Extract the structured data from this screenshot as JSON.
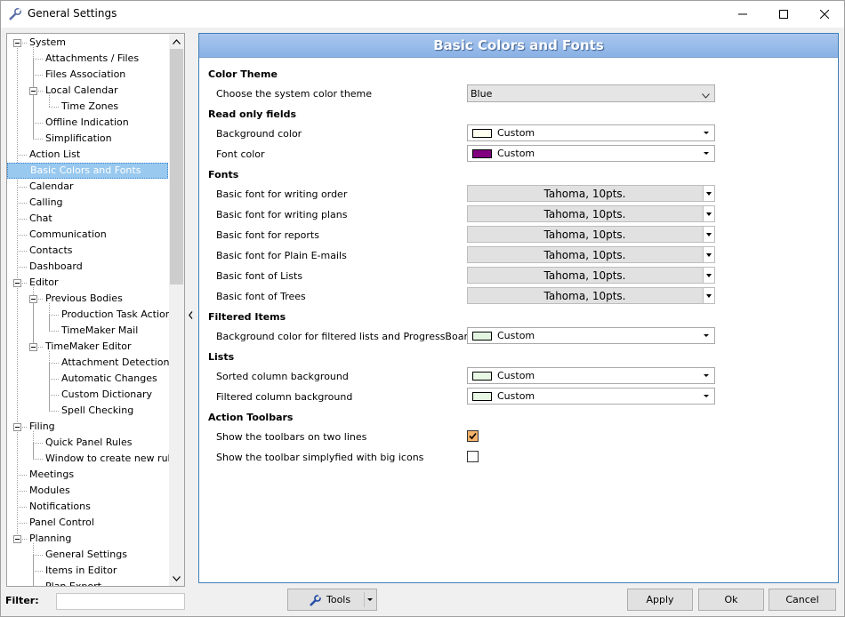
{
  "window": {
    "title": "General Settings"
  },
  "tree": {
    "items": [
      {
        "label": "System",
        "level": 0,
        "expander": true
      },
      {
        "label": "Attachments / Files",
        "level": 1
      },
      {
        "label": "Files Association",
        "level": 1
      },
      {
        "label": "Local Calendar",
        "level": 1,
        "expander": true
      },
      {
        "label": "Time Zones",
        "level": 2
      },
      {
        "label": "Offline Indication",
        "level": 1
      },
      {
        "label": "Simplification",
        "level": 1
      },
      {
        "label": "Action List",
        "level": 0
      },
      {
        "label": "Basic Colors and Fonts",
        "level": 0,
        "selected": true
      },
      {
        "label": "Calendar",
        "level": 0
      },
      {
        "label": "Calling",
        "level": 0
      },
      {
        "label": "Chat",
        "level": 0
      },
      {
        "label": "Communication",
        "level": 0
      },
      {
        "label": "Contacts",
        "level": 0
      },
      {
        "label": "Dashboard",
        "level": 0
      },
      {
        "label": "Editor",
        "level": 0,
        "expander": true
      },
      {
        "label": "Previous Bodies",
        "level": 1,
        "expander": true
      },
      {
        "label": "Production Task Action",
        "level": 2
      },
      {
        "label": "TimeMaker Mail",
        "level": 2
      },
      {
        "label": "TimeMaker Editor",
        "level": 1,
        "expander": true
      },
      {
        "label": "Attachment Detection",
        "level": 2
      },
      {
        "label": "Automatic Changes",
        "level": 2
      },
      {
        "label": "Custom Dictionary",
        "level": 2
      },
      {
        "label": "Spell Checking",
        "level": 2
      },
      {
        "label": "Filing",
        "level": 0,
        "expander": true
      },
      {
        "label": "Quick Panel Rules",
        "level": 1
      },
      {
        "label": "Window to create new rule",
        "level": 1
      },
      {
        "label": "Meetings",
        "level": 0
      },
      {
        "label": "Modules",
        "level": 0
      },
      {
        "label": "Notifications",
        "level": 0
      },
      {
        "label": "Panel Control",
        "level": 0
      },
      {
        "label": "Planning",
        "level": 0,
        "expander": true
      },
      {
        "label": "General Settings",
        "level": 1
      },
      {
        "label": "Items in Editor",
        "level": 1
      },
      {
        "label": "Plan Export",
        "level": 1
      }
    ]
  },
  "panel": {
    "title": "Basic Colors and Fonts",
    "color_theme": {
      "heading": "Color Theme",
      "label": "Choose the system color theme",
      "value": "Blue"
    },
    "read_only": {
      "heading": "Read only fields",
      "background_label": "Background color",
      "background_value": "Custom",
      "background_color": "#fffff0",
      "font_label": "Font color",
      "font_value": "Custom",
      "font_color": "#800080"
    },
    "fonts": {
      "heading": "Fonts",
      "rows": [
        {
          "label": "Basic font for writing order",
          "value": "Tahoma, 10pts."
        },
        {
          "label": "Basic font for writing plans",
          "value": "Tahoma, 10pts."
        },
        {
          "label": "Basic font for reports",
          "value": "Tahoma, 10pts."
        },
        {
          "label": "Basic font for Plain E-mails",
          "value": "Tahoma, 10pts."
        },
        {
          "label": "Basic font of Lists",
          "value": "Tahoma, 10pts."
        },
        {
          "label": "Basic font of Trees",
          "value": "Tahoma, 10pts."
        }
      ]
    },
    "filtered": {
      "heading": "Filtered Items",
      "label": "Background color for filtered lists and ProgressBoard",
      "value": "Custom",
      "color": "#e3f5e1"
    },
    "lists": {
      "heading": "Lists",
      "sorted_label": "Sorted column background",
      "sorted_value": "Custom",
      "sorted_color": "#e8f8e4",
      "filtered_label": "Filtered column background",
      "filtered_value": "Custom",
      "filtered_color": "#e8f8e4"
    },
    "toolbars": {
      "heading": "Action Toolbars",
      "two_lines_label": "Show the toolbars on two lines",
      "two_lines_checked": true,
      "big_icons_label": "Show the toolbar simplyfied with big icons",
      "big_icons_checked": false
    }
  },
  "footer": {
    "filter_label": "Filter:",
    "filter_value": "",
    "tools_label": "Tools",
    "apply_label": "Apply",
    "ok_label": "Ok",
    "cancel_label": "Cancel"
  }
}
